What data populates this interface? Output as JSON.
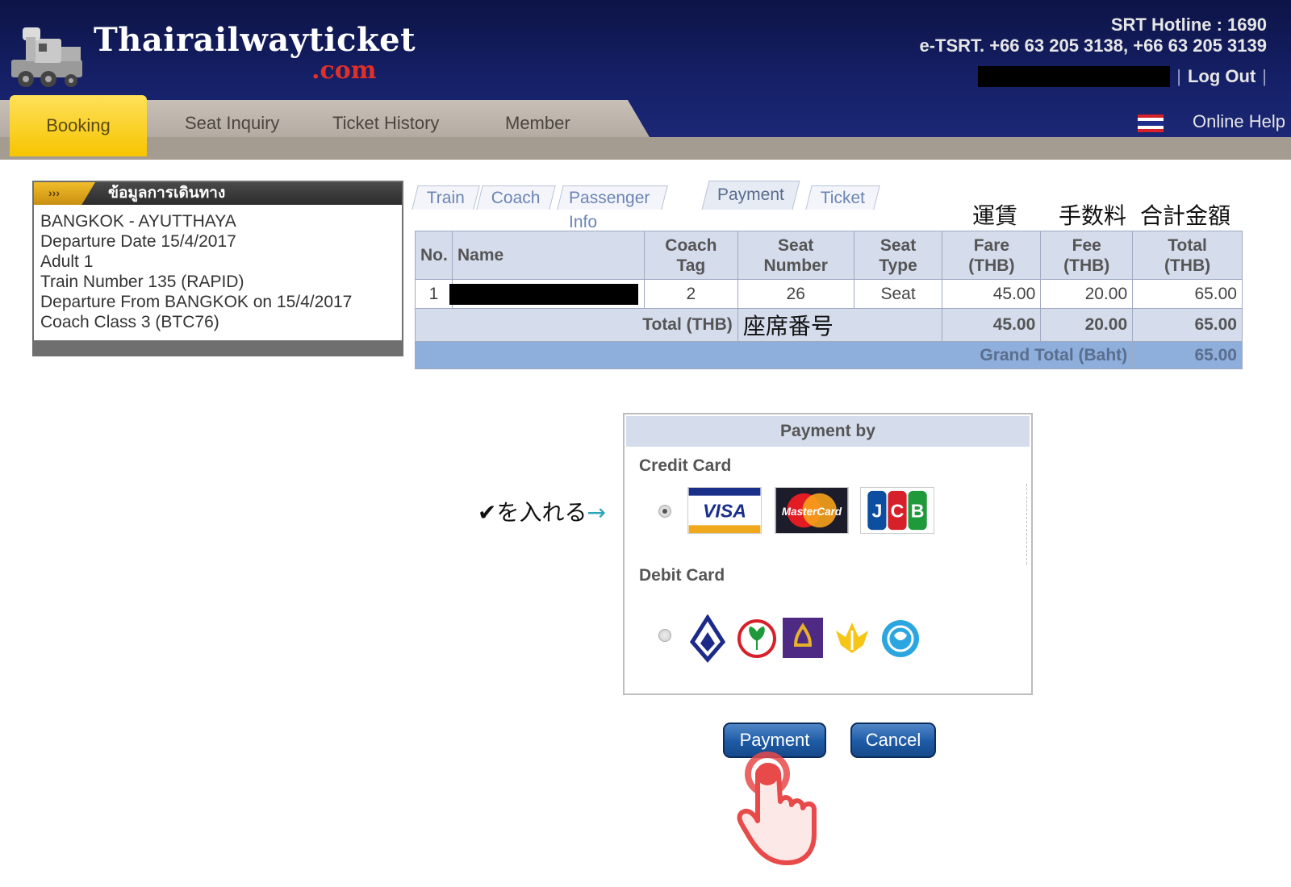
{
  "header": {
    "site_title": "Thairailwayticket",
    "site_suffix": ".com",
    "hotline": "SRT Hotline : 1690",
    "contact": "e-TSRT. +66 63 205 3138, +66 63 205 3139",
    "logout": "Log Out",
    "online_help": "Online Help"
  },
  "nav": {
    "items": [
      "Booking",
      "Seat Inquiry",
      "Ticket History",
      "Member"
    ],
    "active": "Booking"
  },
  "journey": {
    "arrow": "›››",
    "title": "ข้อมูลการเดินทาง",
    "lines": [
      "BANGKOK - AYUTTHAYA",
      "Departure Date 15/4/2017",
      "Adult 1",
      "Train Number 135 (RAPID)",
      "Departure From BANGKOK on 15/4/2017",
      "Coach Class 3 (BTC76)"
    ]
  },
  "steps": {
    "items": [
      "Train",
      "Coach",
      "Passenger Info",
      "Payment",
      "Ticket"
    ],
    "active": "Payment"
  },
  "annotations": {
    "fare": "運賃",
    "fee": "手数料",
    "total_amount": "合計金額",
    "seat_number": "座席番号",
    "check_here": "✔を入れる",
    "arrow": "→"
  },
  "fare_table": {
    "headers": {
      "no": "No.",
      "name": "Name",
      "coach_tag_1": "Coach",
      "coach_tag_2": "Tag",
      "seat_number_1": "Seat",
      "seat_number_2": "Number",
      "seat_type_1": "Seat",
      "seat_type_2": "Type",
      "fare_1": "Fare",
      "fare_2": "(THB)",
      "fee_1": "Fee",
      "fee_2": "(THB)",
      "total_1": "Total",
      "total_2": "(THB)"
    },
    "rows": [
      {
        "no": "1",
        "coach_tag": "2",
        "seat_number": "26",
        "seat_type": "Seat",
        "fare": "45.00",
        "fee": "20.00",
        "total": "65.00"
      }
    ],
    "total_label": "Total (THB)",
    "total_fare": "45.00",
    "total_fee": "20.00",
    "total_total": "65.00",
    "grand_label": "Grand Total (Baht)",
    "grand_value": "65.00"
  },
  "payment": {
    "title": "Payment by",
    "credit_label": "Credit Card",
    "debit_label": "Debit Card",
    "credit_cards": [
      "VISA",
      "MasterCard",
      "JCB"
    ],
    "credit_selected": true,
    "debit_selected": false,
    "bank_icons": [
      "bangkok-bank-icon",
      "kasikorn-bank-icon",
      "scb-bank-icon",
      "krungsri-bank-icon",
      "krungthai-bank-icon"
    ]
  },
  "buttons": {
    "payment": "Payment",
    "cancel": "Cancel"
  },
  "colors": {
    "header_bg": "#16216a",
    "booking_tab": "#f6c400",
    "table_header": "#d5dcec",
    "grand_total_row": "#8eaedc",
    "button_blue": "#1d5aa5",
    "hand_red": "#e84a4a"
  }
}
